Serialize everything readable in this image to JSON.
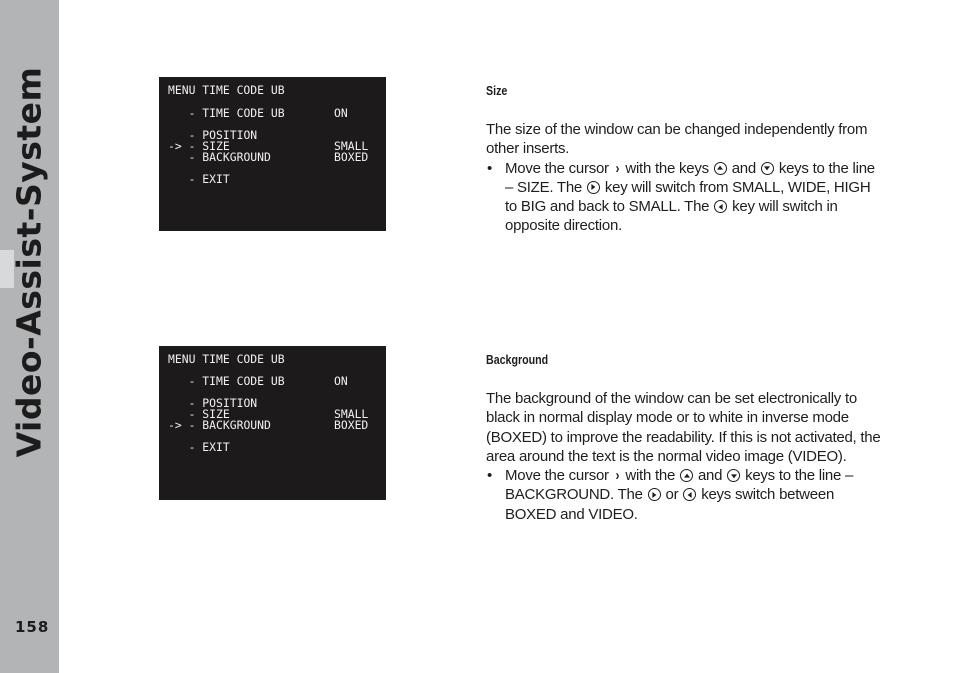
{
  "sidebar": {
    "title": "Video-Assist-System",
    "page_number": "158"
  },
  "osd_screens": [
    {
      "title": "MENU TIME CODE UB",
      "rows": [
        {
          "cursor": "  ",
          "label": " - TIME CODE UB",
          "value": "ON"
        },
        {
          "cursor": "  ",
          "label": " - POSITION",
          "value": ""
        },
        {
          "cursor": "->",
          "label": " - SIZE",
          "value": "SMALL"
        },
        {
          "cursor": "  ",
          "label": " - BACKGROUND",
          "value": "BOXED"
        },
        {
          "cursor": "  ",
          "label": " - EXIT",
          "value": ""
        }
      ]
    },
    {
      "title": "MENU TIME CODE UB",
      "rows": [
        {
          "cursor": "  ",
          "label": " - TIME CODE UB",
          "value": "ON"
        },
        {
          "cursor": "  ",
          "label": " - POSITION",
          "value": ""
        },
        {
          "cursor": "  ",
          "label": " - SIZE",
          "value": "SMALL"
        },
        {
          "cursor": "->",
          "label": " - BACKGROUND",
          "value": "BOXED"
        },
        {
          "cursor": "  ",
          "label": " - EXIT",
          "value": ""
        }
      ]
    }
  ],
  "sections": [
    {
      "heading": "Size",
      "paragraph": "The size of the window can be changed independently from other inserts.",
      "bullet": {
        "dot": "•",
        "parts": {
          "p1": "Move the cursor",
          "cursor_glyph": "›",
          "p2": "with the keys",
          "p3": "and",
          "p4": "keys to the line – SIZE. The",
          "p5": "key will switch from SMALL, WIDE, HIGH to BIG and back to SMALL. The",
          "p6": "key will switch in opposite direction."
        },
        "icons": [
          "cursor-icon",
          "key-up-icon",
          "key-down-icon",
          "key-right-icon",
          "key-left-icon"
        ]
      }
    },
    {
      "heading": "Background",
      "paragraph": "The background of the window can be set electronically to black in normal display mode or to white in inverse mode (BOXED) to improve the readability. If this is not activated, the area around the text is the normal video image (VIDEO).",
      "bullet": {
        "dot": "•",
        "parts": {
          "p1": "Move the cursor",
          "cursor_glyph": "›",
          "p2": "with the",
          "p3": "and",
          "p4": "keys to the line – BACKGROUND. The",
          "p5": "or",
          "p6": "keys switch between BOXED and VIDEO."
        },
        "icons": [
          "cursor-icon",
          "key-up-icon",
          "key-down-icon",
          "key-right-icon",
          "key-left-icon"
        ]
      }
    }
  ]
}
